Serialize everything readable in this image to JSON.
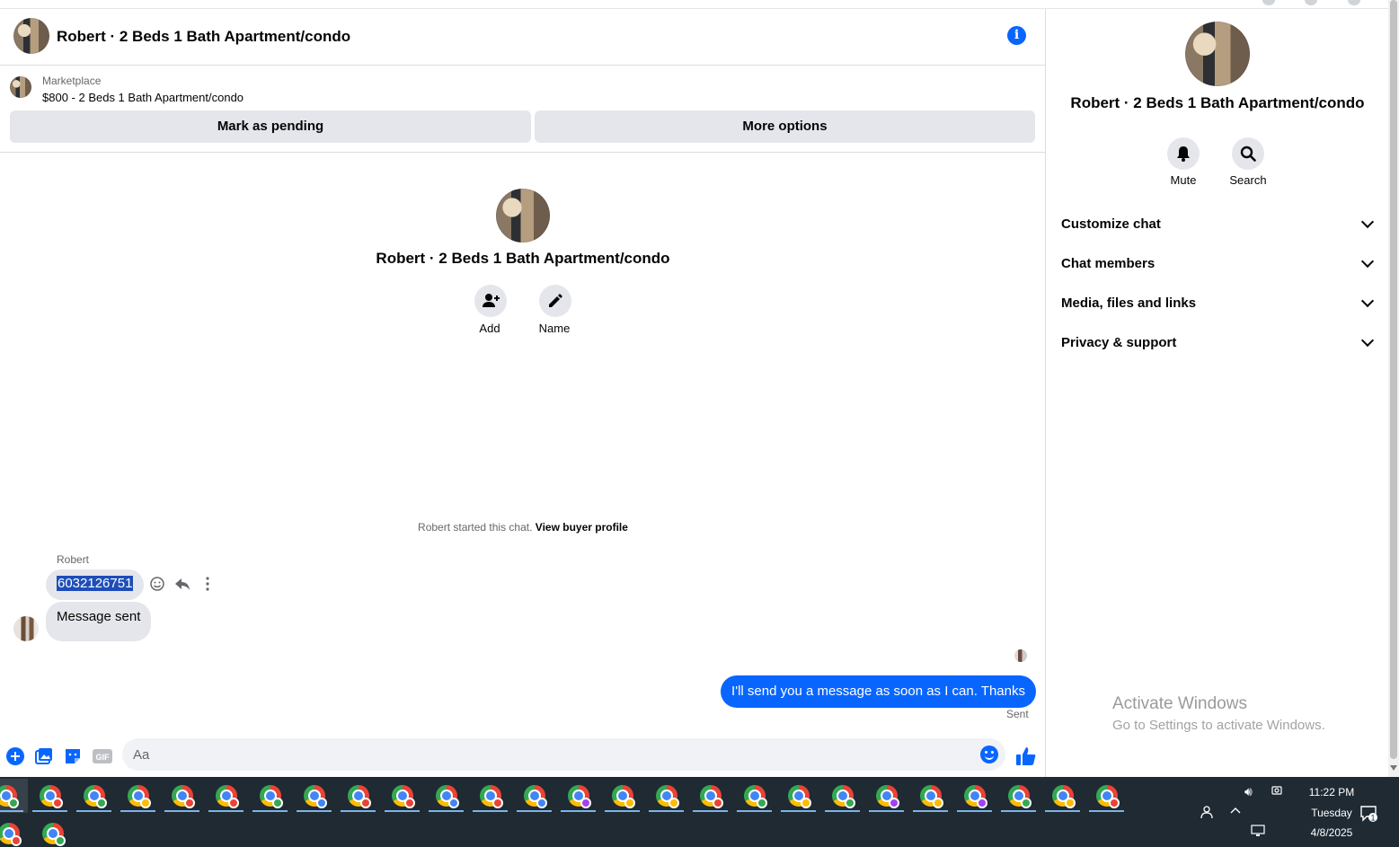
{
  "header": {
    "title": "Robert · 2 Beds 1 Bath Apartment/condo",
    "info_icon": "i"
  },
  "listing": {
    "category": "Marketplace",
    "title": "$800 - 2 Beds 1 Bath Apartment/condo",
    "mark_pending": "Mark as pending",
    "more_options": "More options"
  },
  "intro": {
    "title": "Robert · 2 Beds 1 Bath Apartment/condo",
    "add_label": "Add",
    "name_label": "Name",
    "started_text": "Robert started this chat.",
    "view_profile": "View buyer profile"
  },
  "messages": {
    "sender": "Robert",
    "phone": "6032126751",
    "incoming_2": "Message sent",
    "outgoing": "I'll send you a message as soon as I can. Thanks",
    "status": "Sent"
  },
  "composer": {
    "placeholder": "Aa",
    "gif_label": "GIF"
  },
  "info_panel": {
    "title": "Robert · 2 Beds 1 Bath Apartment/condo",
    "mute": "Mute",
    "search": "Search",
    "sections": [
      "Customize chat",
      "Chat members",
      "Media, files and links",
      "Privacy & support"
    ]
  },
  "watermark": {
    "line1": "Activate Windows",
    "line2": "Go to Settings to activate Windows."
  },
  "taskbar": {
    "time": "11:22 PM",
    "day": "Tuesday",
    "date": "4/8/2025",
    "notification_count": "1",
    "row1_badges": [
      "#34a853",
      "#ea4335",
      "#34a853",
      "#fbbc05",
      "#ea4335",
      "#ea4335",
      "#34a853",
      "#4285f4",
      "#ea4335",
      "#ea4335",
      "#4285f4",
      "#ea4335",
      "#4285f4",
      "#a142f4",
      "#fbbc05",
      "#fbbc05",
      "#ea4335",
      "#34a853",
      "#fbbc05",
      "#34a853",
      "#a142f4",
      "#fbbc05",
      "#a142f4",
      "#34a853",
      "#fbbc05",
      "#ea4335"
    ],
    "row2_badges": [
      "#ea4335",
      "#34a853"
    ]
  },
  "colors": {
    "accent": "#0866ff",
    "bubble_in": "#e4e6eb",
    "taskbar": "#1f2a33"
  }
}
